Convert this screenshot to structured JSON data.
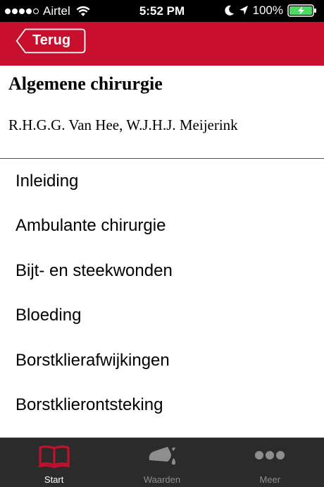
{
  "status_bar": {
    "carrier": "Airtel",
    "time": "5:52 PM",
    "battery": "100%"
  },
  "nav": {
    "back_label": "Terug"
  },
  "header": {
    "title": "Algemene chirurgie",
    "authors": "R.H.G.G. Van Hee, W.J.H.J. Meijerink"
  },
  "chapters": [
    {
      "label": "Inleiding"
    },
    {
      "label": "Ambulante chirurgie"
    },
    {
      "label": "Bijt- en steekwonden"
    },
    {
      "label": "Bloeding"
    },
    {
      "label": "Borstklierafwijkingen"
    },
    {
      "label": "Borstklierontsteking"
    }
  ],
  "tabs": [
    {
      "label": "Start",
      "icon": "book-icon",
      "active": true
    },
    {
      "label": "Waarden",
      "icon": "flask-icon",
      "active": false
    },
    {
      "label": "Meer",
      "icon": "more-dots-icon",
      "active": false
    }
  ],
  "colors": {
    "nav_red": "#c8102e",
    "tab_bar": "#2b2b2b",
    "tab_active_icon": "#c8102e",
    "battery_green": "#4cd964"
  }
}
